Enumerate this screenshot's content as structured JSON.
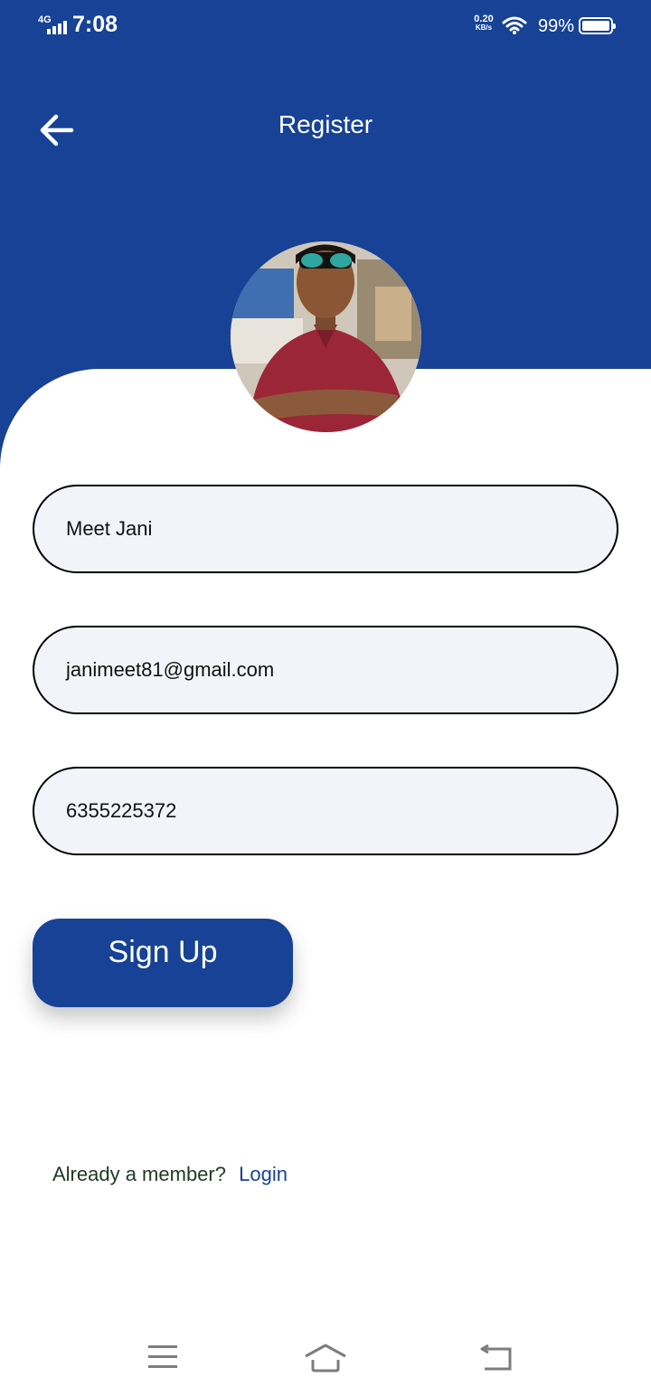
{
  "status_bar": {
    "network": "4G",
    "time": "7:08",
    "speed": "0.20",
    "speed_unit": "KB/s",
    "battery": "99%"
  },
  "header": {
    "title": "Register",
    "back_icon": "arrow-left-icon"
  },
  "profile": {
    "avatar": "profile-photo"
  },
  "form": {
    "name_value": "Meet Jani",
    "email_value": "janimeet81@gmail.com",
    "phone_value": "6355225372",
    "submit_label": "Sign Up"
  },
  "footer": {
    "prompt": "Already a member?",
    "login_label": "Login"
  },
  "nav": {
    "menu_icon": "menu-icon",
    "home_icon": "home-icon",
    "back_icon": "back-icon"
  },
  "colors": {
    "primary": "#174295",
    "field_bg": "#f3f4fa",
    "prompt_text": "#1f3a22"
  }
}
